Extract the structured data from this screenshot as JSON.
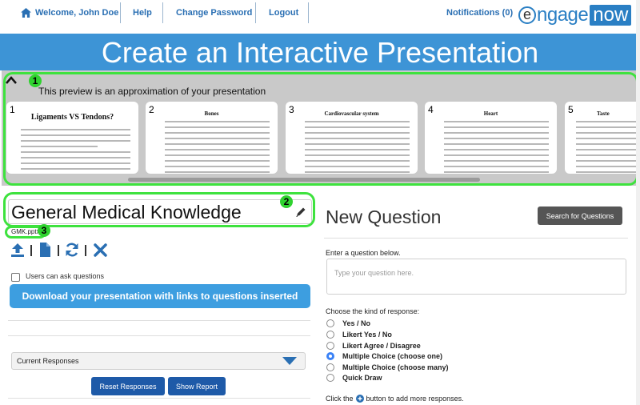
{
  "nav": {
    "welcome": "Welcome, John Doe",
    "help": "Help",
    "change_password": "Change Password",
    "logout": "Logout",
    "notifications": "Notifications (0)",
    "logo_engage": "ngage",
    "logo_e": "e",
    "logo_now": "now"
  },
  "banner": {
    "title": "Create an Interactive Presentation"
  },
  "preview": {
    "note": "This preview is an approximation of your presentation",
    "slides": [
      {
        "num": "1",
        "title": "Ligaments VS Tendons?"
      },
      {
        "num": "2",
        "title": "Bones"
      },
      {
        "num": "3",
        "title": "Cardiovascular system"
      },
      {
        "num": "4",
        "title": "Heart"
      },
      {
        "num": "5",
        "title": "Taste"
      }
    ]
  },
  "annotations": {
    "badge1": "1",
    "badge2": "2",
    "badge3": "3"
  },
  "presentation": {
    "title": "General Medical Knowledge",
    "file": "GMK.pptx",
    "users_can_ask_label": "Users can ask questions",
    "download_label": "Download your presentation with links to questions inserted",
    "responses_select": "Current Responses",
    "reset_label": "Reset Responses",
    "show_report_label": "Show Report"
  },
  "question": {
    "heading": "New Question",
    "search_label": "Search for Questions",
    "enter_label": "Enter a question below.",
    "placeholder": "Type your question here.",
    "kind_label": "Choose the kind of response:",
    "options": [
      {
        "label": "Yes / No",
        "selected": false
      },
      {
        "label": "Likert Yes / No",
        "selected": false
      },
      {
        "label": "Likert Agree / Disagree",
        "selected": false
      },
      {
        "label": "Multiple Choice (choose one)",
        "selected": true
      },
      {
        "label": "Multiple Choice (choose many)",
        "selected": false
      },
      {
        "label": "Quick Draw",
        "selected": false
      }
    ],
    "footer_before": "Click the",
    "footer_after": "button to add more responses."
  },
  "colors": {
    "brand": "#2a7fc4",
    "banner": "#3d94d6",
    "annotation": "#3ee23e",
    "dark_button": "#1e5aa8"
  }
}
